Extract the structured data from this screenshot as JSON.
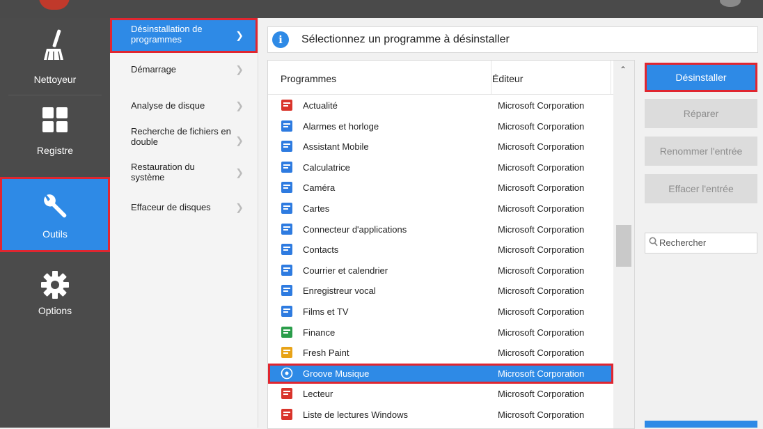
{
  "sidebar": {
    "items": [
      {
        "label": "Nettoyeur",
        "icon": "broom-icon"
      },
      {
        "label": "Registre",
        "icon": "grid-icon"
      },
      {
        "label": "Outils",
        "icon": "wrench-icon"
      },
      {
        "label": "Options",
        "icon": "gear-icon"
      }
    ],
    "active": "Outils"
  },
  "submenu": {
    "items": [
      {
        "label": "Désinstallation de programmes"
      },
      {
        "label": "Démarrage"
      },
      {
        "label": "Analyse de disque"
      },
      {
        "label": "Recherche de fichiers en double"
      },
      {
        "label": "Restauration du système"
      },
      {
        "label": "Effaceur de disques"
      }
    ],
    "active": "Désinstallation de programmes"
  },
  "info": {
    "text": "Sélectionnez un programme à désinstaller",
    "icon": "info-icon"
  },
  "table": {
    "headers": {
      "name": "Programmes",
      "publisher": "Éditeur"
    },
    "rows": [
      {
        "name": "Actualité",
        "publisher": "Microsoft Corporation",
        "icon": "news-icon"
      },
      {
        "name": "Alarmes et horloge",
        "publisher": "Microsoft Corporation",
        "icon": "alarm-icon"
      },
      {
        "name": "Assistant Mobile",
        "publisher": "Microsoft Corporation",
        "icon": "phone-icon"
      },
      {
        "name": "Calculatrice",
        "publisher": "Microsoft Corporation",
        "icon": "calculator-icon"
      },
      {
        "name": "Caméra",
        "publisher": "Microsoft Corporation",
        "icon": "camera-icon"
      },
      {
        "name": "Cartes",
        "publisher": "Microsoft Corporation",
        "icon": "maps-icon"
      },
      {
        "name": "Connecteur d'applications",
        "publisher": "Microsoft Corporation",
        "icon": "connector-icon"
      },
      {
        "name": "Contacts",
        "publisher": "Microsoft Corporation",
        "icon": "contacts-icon"
      },
      {
        "name": "Courrier et calendrier",
        "publisher": "Microsoft Corporation",
        "icon": "mail-icon"
      },
      {
        "name": "Enregistreur vocal",
        "publisher": "Microsoft Corporation",
        "icon": "recorder-icon"
      },
      {
        "name": "Films et TV",
        "publisher": "Microsoft Corporation",
        "icon": "film-icon"
      },
      {
        "name": "Finance",
        "publisher": "Microsoft Corporation",
        "icon": "finance-icon"
      },
      {
        "name": "Fresh Paint",
        "publisher": "Microsoft Corporation",
        "icon": "paint-icon"
      },
      {
        "name": "Groove Musique",
        "publisher": "Microsoft Corporation",
        "icon": "music-icon"
      },
      {
        "name": "Lecteur",
        "publisher": "Microsoft Corporation",
        "icon": "reader-icon"
      },
      {
        "name": "Liste de lectures Windows",
        "publisher": "Microsoft Corporation",
        "icon": "readinglist-icon"
      }
    ],
    "selected": "Groove Musique"
  },
  "actions": {
    "uninstall": "Désinstaller",
    "repair": "Réparer",
    "rename": "Renommer l'entrée",
    "delete": "Effacer l'entrée"
  },
  "search": {
    "placeholder": "Rechercher"
  },
  "colors": {
    "accent": "#2e8ae6",
    "highlight": "#e02630",
    "sidebar": "#4b4b4b"
  }
}
